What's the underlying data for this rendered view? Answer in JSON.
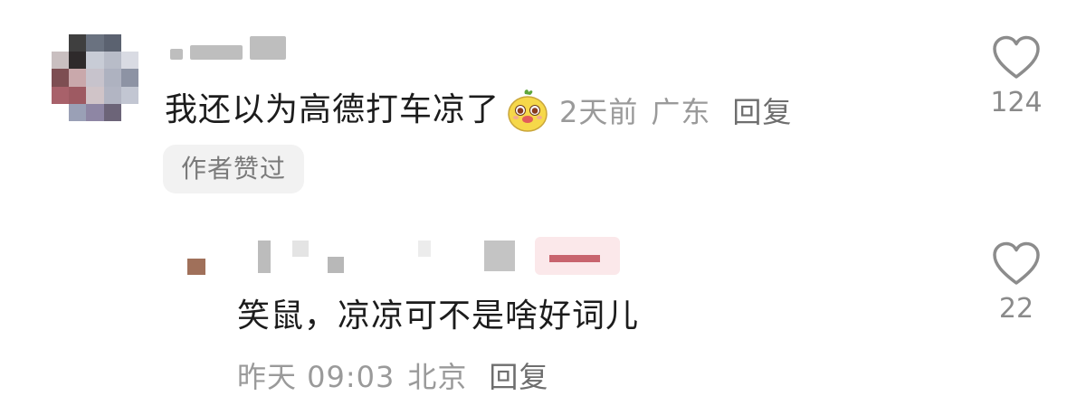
{
  "main_comment": {
    "text": "我还以为高德打车凉了",
    "time": "2天前",
    "location": "广东",
    "reply_label": "回复",
    "badge": "作者赞过",
    "like_count": "124"
  },
  "reply_comment": {
    "text": "笑鼠，凉凉可不是啥好词儿",
    "time": "昨天 09:03",
    "location": "北京",
    "reply_label": "回复",
    "like_count": "22"
  },
  "colors": {
    "meta_text": "#9a9a9a",
    "badge_bg": "#f2f2f2",
    "heart_stroke": "#8c8c8c"
  },
  "icons": {
    "like": "heart-outline-icon",
    "sticker": "yellow-creature-emoji-icon"
  }
}
